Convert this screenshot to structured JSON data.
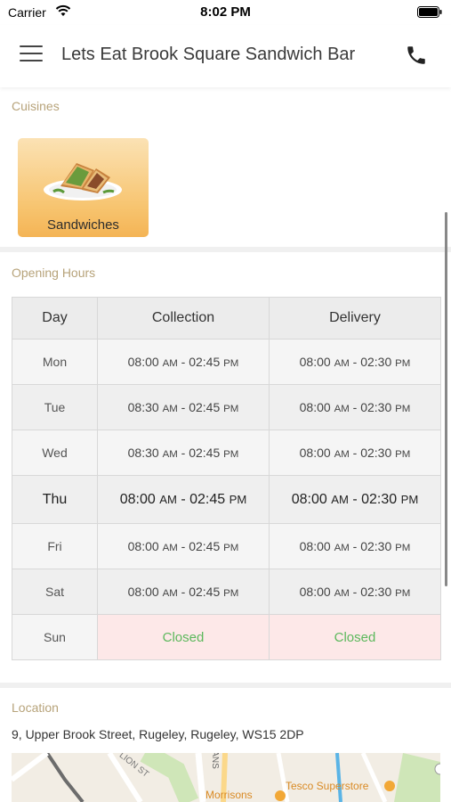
{
  "status_bar": {
    "carrier": "Carrier",
    "time": "8:02 PM"
  },
  "header": {
    "title": "Lets Eat Brook Square Sandwich Bar",
    "menu_icon": "hamburger-menu-icon",
    "phone_icon": "phone-icon"
  },
  "cuisines": {
    "label": "Cuisines",
    "items": [
      {
        "label": "Sandwiches"
      }
    ]
  },
  "opening_hours": {
    "label": "Opening Hours",
    "headers": {
      "day": "Day",
      "collection": "Collection",
      "delivery": "Delivery"
    },
    "rows": [
      {
        "day": "Mon",
        "collection": {
          "from": "08:00",
          "from_ampm": "AM",
          "to": "02:45",
          "to_ampm": "PM"
        },
        "delivery": {
          "from": "08:00",
          "from_ampm": "AM",
          "to": "02:30",
          "to_ampm": "PM"
        }
      },
      {
        "day": "Tue",
        "collection": {
          "from": "08:30",
          "from_ampm": "AM",
          "to": "02:45",
          "to_ampm": "PM"
        },
        "delivery": {
          "from": "08:00",
          "from_ampm": "AM",
          "to": "02:30",
          "to_ampm": "PM"
        }
      },
      {
        "day": "Wed",
        "collection": {
          "from": "08:30",
          "from_ampm": "AM",
          "to": "02:45",
          "to_ampm": "PM"
        },
        "delivery": {
          "from": "08:00",
          "from_ampm": "AM",
          "to": "02:30",
          "to_ampm": "PM"
        }
      },
      {
        "day": "Thu",
        "collection": {
          "from": "08:00",
          "from_ampm": "AM",
          "to": "02:45",
          "to_ampm": "PM"
        },
        "delivery": {
          "from": "08:00",
          "from_ampm": "AM",
          "to": "02:30",
          "to_ampm": "PM"
        }
      },
      {
        "day": "Fri",
        "collection": {
          "from": "08:00",
          "from_ampm": "AM",
          "to": "02:45",
          "to_ampm": "PM"
        },
        "delivery": {
          "from": "08:00",
          "from_ampm": "AM",
          "to": "02:30",
          "to_ampm": "PM"
        }
      },
      {
        "day": "Sat",
        "collection": {
          "from": "08:00",
          "from_ampm": "AM",
          "to": "02:45",
          "to_ampm": "PM"
        },
        "delivery": {
          "from": "08:00",
          "from_ampm": "AM",
          "to": "02:30",
          "to_ampm": "PM"
        }
      }
    ],
    "closed_row": {
      "day": "Sun",
      "collection": "Closed",
      "delivery": "Closed"
    },
    "closed_color": "#5cb85c",
    "closed_bg": "#fde8e8"
  },
  "location": {
    "label": "Location",
    "address": "9, Upper Brook Street, Rugeley, Rugeley, WS15 2DP",
    "map": {
      "street_label_1": "LION ST",
      "street_label_2": "ANS",
      "poi_1": "Morrisons",
      "poi_2": "Tesco Superstore",
      "poi_icon": "shopping-cart-icon"
    }
  },
  "colors": {
    "accent_label": "#b7a37a",
    "tile_orange": "#f7c46f"
  }
}
